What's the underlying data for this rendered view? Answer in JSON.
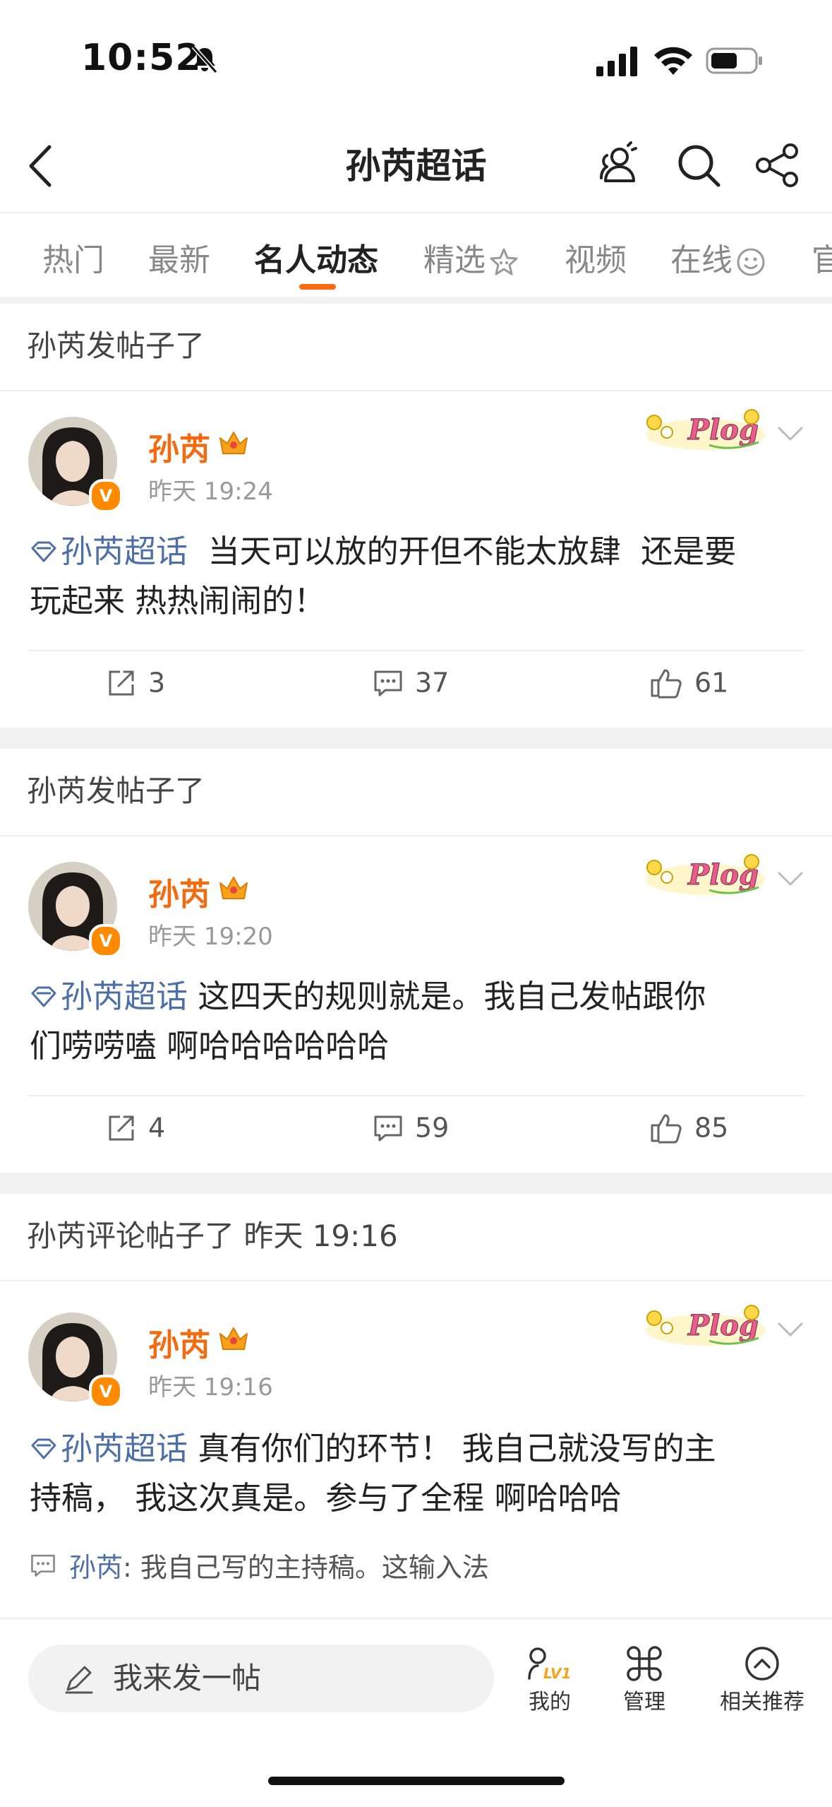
{
  "status_bar": {
    "time": "10:52"
  },
  "nav": {
    "title": "孙芮超话"
  },
  "tabs": [
    {
      "label": "热门"
    },
    {
      "label": "最新"
    },
    {
      "label": "名人动态",
      "active": true
    },
    {
      "label": "精选"
    },
    {
      "label": "视频"
    },
    {
      "label": "在线"
    },
    {
      "label": "官"
    }
  ],
  "posts": [
    {
      "header": "孙芮发帖子了",
      "author": "孙芮",
      "time": "昨天 19:24",
      "topic": "孙芮超话",
      "text": "当天可以放的开但不能太放肆 还是要玩起来 热热闹闹的！",
      "line1": "  当天可以放的开但不能太放肆  还是要",
      "line2": "玩起来 热热闹闹的！",
      "reposts": "3",
      "comments": "37",
      "likes": "61"
    },
    {
      "header": "孙芮发帖子了",
      "author": "孙芮",
      "time": "昨天 19:20",
      "topic": "孙芮超话",
      "line1": " 这四天的规则就是。我自己发帖跟你",
      "line2": "们唠唠嗑 啊哈哈哈哈哈哈",
      "reposts": "4",
      "comments": "59",
      "likes": "85"
    },
    {
      "header": "孙芮评论帖子了 昨天 19:16",
      "author": "孙芮",
      "time": "昨天 19:16",
      "topic": "孙芮超话",
      "line1": " 真有你们的环节！ 我自己就没写的主",
      "line2": "持稿， 我这次真是。参与了全程 啊哈哈哈",
      "comment_author": "孙芮",
      "comment_text": ": 我自己写的主持稿。这输入法"
    }
  ],
  "plog_label": "Plog",
  "verified_badge": "V",
  "bottom_bar": {
    "composer_placeholder": "我来发一帖",
    "level_badge": "LV1",
    "items": [
      {
        "label": "我的"
      },
      {
        "label": "管理"
      },
      {
        "label": "相关推荐"
      }
    ]
  },
  "colors": {
    "accent": "#ff6a13",
    "username": "#f26b10",
    "topic": "#4b6fa6"
  }
}
